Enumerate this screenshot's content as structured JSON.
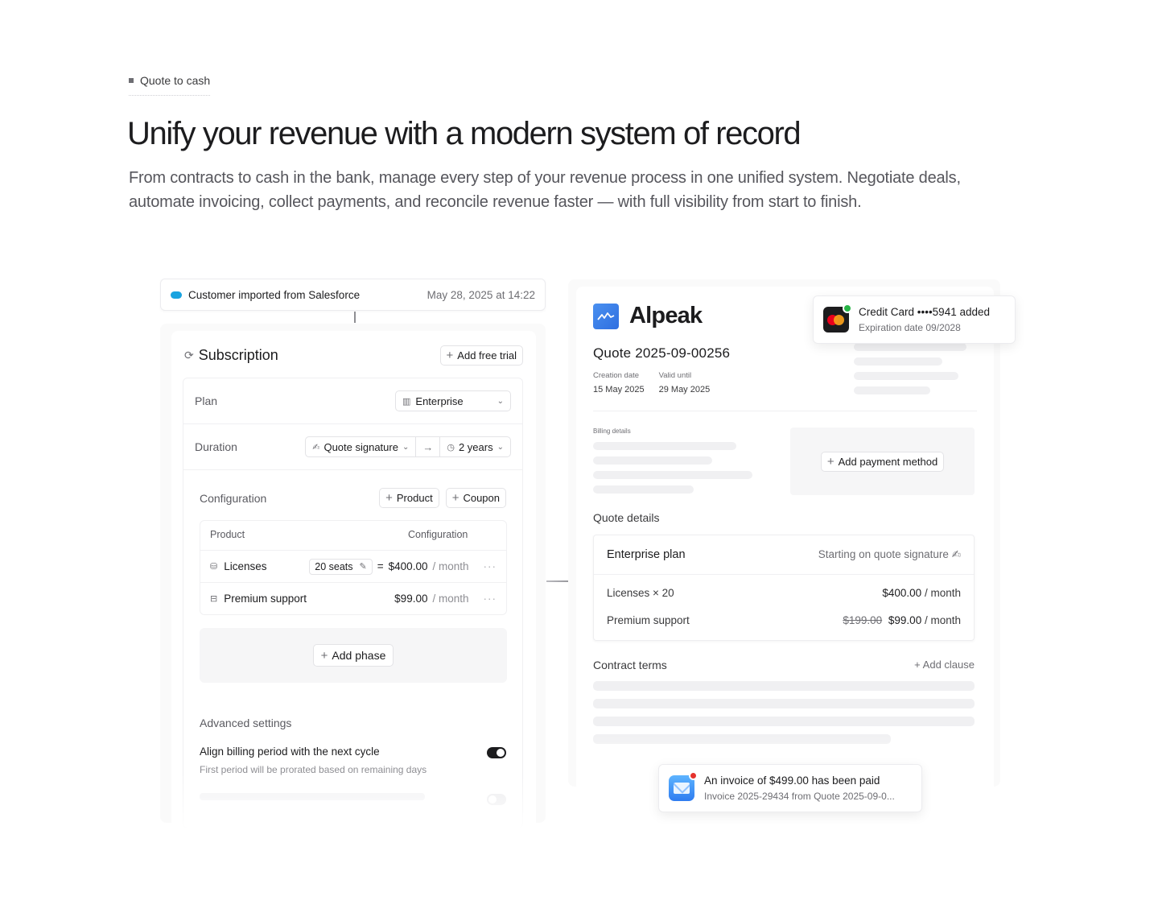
{
  "hero": {
    "eyebrow": "Quote to cash",
    "title": "Unify your revenue with a modern system of record",
    "subtitle": "From contracts to cash in the bank, manage every step of your revenue process in one unified system. Negotiate deals, automate invoicing, collect payments, and reconcile revenue faster — with full visibility from start to finish."
  },
  "salesforce_banner": {
    "text": "Customer imported from Salesforce",
    "timestamp": "May 28, 2025 at 14:22"
  },
  "subscription": {
    "title": "Subscription",
    "add_trial": "Add free trial",
    "plan_label": "Plan",
    "plan_value": "Enterprise",
    "duration_label": "Duration",
    "duration_start": "Quote signature",
    "duration_length": "2 years",
    "config_label": "Configuration",
    "add_product": "Product",
    "add_coupon": "Coupon",
    "table_headers": {
      "product": "Product",
      "configuration": "Configuration"
    },
    "products": [
      {
        "name": "Licenses",
        "seats": "20 seats",
        "eq": "=",
        "price": "$400.00",
        "period": "/ month"
      },
      {
        "name": "Premium support",
        "price": "$99.00",
        "period": "/ month"
      }
    ],
    "add_phase": "Add phase",
    "advanced_title": "Advanced settings",
    "advanced_item_title": "Align billing period with the next cycle",
    "advanced_item_desc": "First period will be prorated based on remaining days",
    "align_toggle_on": true
  },
  "quote": {
    "brand": "Alpeak",
    "number": "Quote 2025-09-00256",
    "creation_label": "Creation date",
    "creation_value": "15 May 2025",
    "valid_label": "Valid until",
    "valid_value": "29 May 2025",
    "billing_label": "Billing details",
    "add_payment": "Add payment method",
    "details_title": "Quote details",
    "plan_name": "Enterprise plan",
    "plan_start": "Starting on quote signature",
    "lines": [
      {
        "name": "Licenses × 20",
        "old": "",
        "price": "$400.00",
        "period": "/ month"
      },
      {
        "name": "Premium support",
        "old": "$199.00",
        "price": "$99.00",
        "period": "/ month"
      }
    ],
    "terms_title": "Contract terms",
    "add_clause": "Add clause"
  },
  "card_toast": {
    "title": "Credit Card ••••5941 added",
    "subtitle": "Expiration date 09/2028"
  },
  "invoice_toast": {
    "title": "An invoice of $499.00 has been paid",
    "subtitle": "Invoice 2025-29434 from Quote 2025-09-0..."
  },
  "icons": [
    "square-bullet-icon",
    "salesforce-cloud-icon",
    "sync-icon",
    "plus-icon",
    "plan-icon",
    "chevron-down-icon",
    "signature-icon",
    "arrow-right-icon",
    "clock-icon",
    "licenses-icon",
    "edit-icon",
    "support-icon",
    "more-icon",
    "alpeak-logo-icon",
    "mastercard-icon",
    "check-icon",
    "mail-icon"
  ]
}
